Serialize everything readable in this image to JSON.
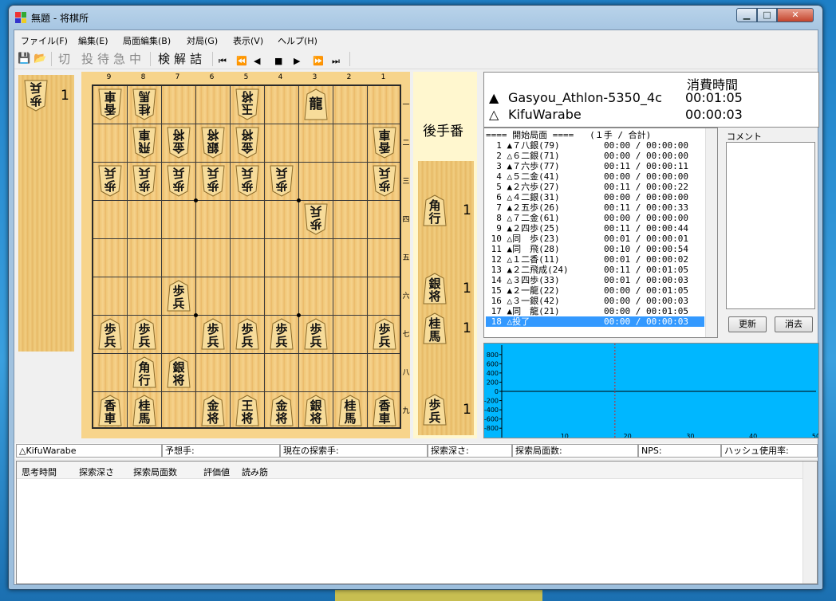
{
  "window": {
    "title": "無題 - 将棋所"
  },
  "menu": [
    "ファイル(F)",
    "編集(E)",
    "局面編集(B)",
    "対局(G)",
    "表示(V)",
    "ヘルプ(H)"
  ],
  "toolbar": {
    "kanji": [
      "切",
      "投",
      "待",
      "急",
      "中",
      "検",
      "解",
      "詰"
    ],
    "kanji_enabled": [
      false,
      false,
      false,
      false,
      false,
      true,
      true,
      true
    ],
    "nav": [
      "⏮",
      "⏪",
      "◀",
      "■",
      "▶",
      "⏩",
      "⏭"
    ]
  },
  "board": {
    "file_labels": [
      "9",
      "8",
      "7",
      "6",
      "5",
      "4",
      "3",
      "2",
      "1"
    ],
    "rank_labels": [
      "一",
      "二",
      "三",
      "四",
      "五",
      "六",
      "七",
      "八",
      "九"
    ],
    "pieces": [
      {
        "file": 9,
        "rank": 1,
        "text": "香車",
        "side": "gote"
      },
      {
        "file": 8,
        "rank": 1,
        "text": "桂馬",
        "side": "gote"
      },
      {
        "file": 5,
        "rank": 1,
        "text": "玉将",
        "side": "gote"
      },
      {
        "file": 3,
        "rank": 1,
        "text": "龍",
        "side": "sente"
      },
      {
        "file": 8,
        "rank": 2,
        "text": "飛車",
        "side": "gote"
      },
      {
        "file": 7,
        "rank": 2,
        "text": "金将",
        "side": "gote"
      },
      {
        "file": 6,
        "rank": 2,
        "text": "銀将",
        "side": "gote"
      },
      {
        "file": 5,
        "rank": 2,
        "text": "金将",
        "side": "gote"
      },
      {
        "file": 1,
        "rank": 2,
        "text": "香車",
        "side": "gote"
      },
      {
        "file": 9,
        "rank": 3,
        "text": "歩兵",
        "side": "gote"
      },
      {
        "file": 8,
        "rank": 3,
        "text": "歩兵",
        "side": "gote"
      },
      {
        "file": 7,
        "rank": 3,
        "text": "歩兵",
        "side": "gote"
      },
      {
        "file": 6,
        "rank": 3,
        "text": "歩兵",
        "side": "gote"
      },
      {
        "file": 5,
        "rank": 3,
        "text": "歩兵",
        "side": "gote"
      },
      {
        "file": 4,
        "rank": 3,
        "text": "歩兵",
        "side": "gote"
      },
      {
        "file": 1,
        "rank": 3,
        "text": "歩兵",
        "side": "gote"
      },
      {
        "file": 3,
        "rank": 4,
        "text": "歩兵",
        "side": "gote"
      },
      {
        "file": 7,
        "rank": 6,
        "text": "歩兵",
        "side": "sente"
      },
      {
        "file": 9,
        "rank": 7,
        "text": "歩兵",
        "side": "sente"
      },
      {
        "file": 8,
        "rank": 7,
        "text": "歩兵",
        "side": "sente"
      },
      {
        "file": 6,
        "rank": 7,
        "text": "歩兵",
        "side": "sente"
      },
      {
        "file": 5,
        "rank": 7,
        "text": "歩兵",
        "side": "sente"
      },
      {
        "file": 4,
        "rank": 7,
        "text": "歩兵",
        "side": "sente"
      },
      {
        "file": 3,
        "rank": 7,
        "text": "歩兵",
        "side": "sente"
      },
      {
        "file": 1,
        "rank": 7,
        "text": "歩兵",
        "side": "sente"
      },
      {
        "file": 8,
        "rank": 8,
        "text": "角行",
        "side": "sente"
      },
      {
        "file": 7,
        "rank": 8,
        "text": "銀将",
        "side": "sente"
      },
      {
        "file": 9,
        "rank": 9,
        "text": "香車",
        "side": "sente"
      },
      {
        "file": 8,
        "rank": 9,
        "text": "桂馬",
        "side": "sente"
      },
      {
        "file": 6,
        "rank": 9,
        "text": "金将",
        "side": "sente"
      },
      {
        "file": 5,
        "rank": 9,
        "text": "王将",
        "side": "sente"
      },
      {
        "file": 4,
        "rank": 9,
        "text": "金将",
        "side": "sente"
      },
      {
        "file": 3,
        "rank": 9,
        "text": "銀将",
        "side": "sente"
      },
      {
        "file": 2,
        "rank": 9,
        "text": "桂馬",
        "side": "sente"
      },
      {
        "file": 1,
        "rank": 9,
        "text": "香車",
        "side": "sente"
      }
    ]
  },
  "gote_hand": [
    {
      "text": "歩兵",
      "count": "1"
    }
  ],
  "sente_hand": [
    {
      "text": "角行",
      "count": "1"
    },
    {
      "text": "銀将",
      "count": "1"
    },
    {
      "text": "桂馬",
      "count": "1"
    },
    {
      "text": "歩兵",
      "count": "1"
    }
  ],
  "turn_label": "後手番",
  "players": {
    "time_header": "消費時間",
    "sente_mark": "▲",
    "sente_name": "Gasyou_Athlon-5350_4c",
    "sente_time": "00:01:05",
    "gote_mark": "△",
    "gote_name": "KifuWarabe",
    "gote_time": "00:00:03"
  },
  "kifu": {
    "header": "==== 開始局面 ====   (１手 / 合計)",
    "rows": [
      {
        "move": "  1 ▲７八銀(79)",
        "time": "00:00 / 00:00:00"
      },
      {
        "move": "  2 △６二銀(71)",
        "time": "00:00 / 00:00:00"
      },
      {
        "move": "  3 ▲７六歩(77)",
        "time": "00:11 / 00:00:11"
      },
      {
        "move": "  4 △５二金(41)",
        "time": "00:00 / 00:00:00"
      },
      {
        "move": "  5 ▲２六歩(27)",
        "time": "00:11 / 00:00:22"
      },
      {
        "move": "  6 △４二銀(31)",
        "time": "00:00 / 00:00:00"
      },
      {
        "move": "  7 ▲２五歩(26)",
        "time": "00:11 / 00:00:33"
      },
      {
        "move": "  8 △７二金(61)",
        "time": "00:00 / 00:00:00"
      },
      {
        "move": "  9 ▲２四歩(25)",
        "time": "00:11 / 00:00:44"
      },
      {
        "move": " 10 △同　歩(23)",
        "time": "00:01 / 00:00:01"
      },
      {
        "move": " 11 ▲同　飛(28)",
        "time": "00:10 / 00:00:54"
      },
      {
        "move": " 12 △１二香(11)",
        "time": "00:01 / 00:00:02"
      },
      {
        "move": " 13 ▲２二飛成(24)",
        "time": "00:11 / 00:01:05"
      },
      {
        "move": " 14 △３四歩(33)",
        "time": "00:01 / 00:00:03"
      },
      {
        "move": " 15 ▲２一龍(22)",
        "time": "00:00 / 00:01:05"
      },
      {
        "move": " 16 △３一銀(42)",
        "time": "00:00 / 00:00:03"
      },
      {
        "move": " 17 ▲同　龍(21)",
        "time": "00:00 / 00:01:05"
      },
      {
        "move": " 18 △投了",
        "time": "00:00 / 00:00:03"
      }
    ],
    "selected_index": 17
  },
  "comment": {
    "label": "コメント",
    "update_btn": "更新",
    "clear_btn": "消去"
  },
  "graph": {
    "y_ticks": [
      "800",
      "600",
      "400",
      "200",
      "0",
      "-200",
      "-400",
      "-600",
      "-800"
    ],
    "x_ticks": [
      "10",
      "20",
      "30",
      "40",
      "50"
    ],
    "x_range": [
      0,
      50
    ],
    "y_range": [
      -900,
      900
    ],
    "current_move": 18
  },
  "status": {
    "engine": "△KifuWarabe",
    "predict": "予想手:",
    "current": "現在の探索手:",
    "depth": "探索深さ:",
    "nodes": "探索局面数:",
    "nps": "NPS:",
    "hash": "ハッシュ使用率:"
  },
  "pv_columns": [
    "思考時間",
    "探索深さ",
    "探索局面数",
    "評価値",
    "読み筋"
  ],
  "colors": {
    "graph_bg": "#00b7ff",
    "selection": "#3399ff",
    "board": "#f7d48b"
  }
}
